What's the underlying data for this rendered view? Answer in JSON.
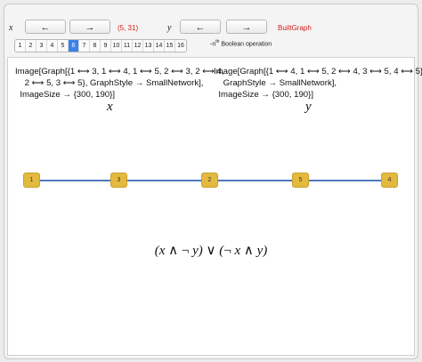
{
  "controls": {
    "x_label": "x",
    "y_label": "y",
    "left_arrow": "←",
    "right_arrow": "→",
    "pair": "(5, 31)",
    "builtin_label": "BuiltGraph",
    "tabs": [
      "1",
      "2",
      "3",
      "4",
      "5",
      "6",
      "7",
      "8",
      "9",
      "10",
      "11",
      "12",
      "13",
      "14",
      "15",
      "16"
    ],
    "active_tab": "6",
    "nth_prefix": "-n",
    "nth_sup": "th",
    "nth_suffix": "Boolean operation"
  },
  "code": {
    "left": "Image[Graph[{1 ⟷ 3, 1 ⟷ 4, 1 ⟷ 5, 2 ⟷ 3, 2 ⟷ 4,\n    2 ⟷ 5, 3 ⟷ 5}, GraphStyle → SmallNetwork],\n  ImageSize → {300, 190}]",
    "right": "Image[Graph[{1 ⟷ 4, 1 ⟷ 5, 2 ⟷ 4, 3 ⟷ 5, 4 ⟷ 5},\n    GraphStyle → SmallNetwork],\n  ImageSize → {300, 190}]",
    "left_var": "x",
    "right_var": "y"
  },
  "graph": {
    "nodes": [
      "1",
      "3",
      "2",
      "5",
      "4"
    ],
    "node_color": "#e3b93e",
    "edge_color": "#4f78bd"
  },
  "formula": {
    "p1_open": "(",
    "x1": "x",
    "and1": " ∧ ",
    "not1": "¬ ",
    "y1": "y",
    "p1_close": ")",
    "or": " ∨ ",
    "p2_open": "(",
    "not2": "¬ ",
    "x2": "x",
    "and2": " ∧ ",
    "y2": "y",
    "p2_close": ")"
  }
}
